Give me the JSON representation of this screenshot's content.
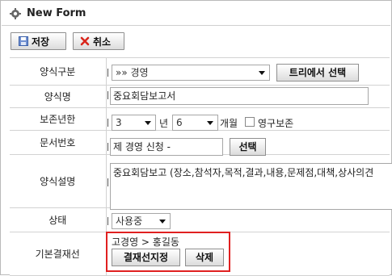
{
  "window": {
    "title": "New Form",
    "icon": "gear-icon"
  },
  "toolbar": {
    "save_label": "저장",
    "save_icon": "save-disk-icon",
    "cancel_label": "취소",
    "cancel_icon": "cancel-x-icon"
  },
  "form": {
    "type": {
      "label": "양식구분",
      "selected": "»» 경영",
      "tree_button": "트리에서 선택"
    },
    "name": {
      "label": "양식명",
      "value": "중요회담보고서"
    },
    "retention": {
      "label": "보존년한",
      "years": "3",
      "year_unit": "년",
      "months": "6",
      "month_unit": "개월",
      "permanent_label": "영구보존",
      "permanent_checked": false
    },
    "doc_number": {
      "label": "문서번호",
      "value": "제 경영 신청  -",
      "select_button": "선택"
    },
    "description": {
      "label": "양식설명",
      "value": "중요회담보고 (장소,참석자,목적,결과,내용,문제점,대책,상사의견"
    },
    "status": {
      "label": "상태",
      "selected": "사용중"
    },
    "approval": {
      "label": "기본결재선",
      "path": "고경영 > 홍길동",
      "designate_button": "결재선지정",
      "delete_button": "삭제"
    }
  },
  "colors": {
    "highlight": "#e02020",
    "cancel_icon": "#d9261c",
    "save_icon": "#3a5fa8"
  }
}
